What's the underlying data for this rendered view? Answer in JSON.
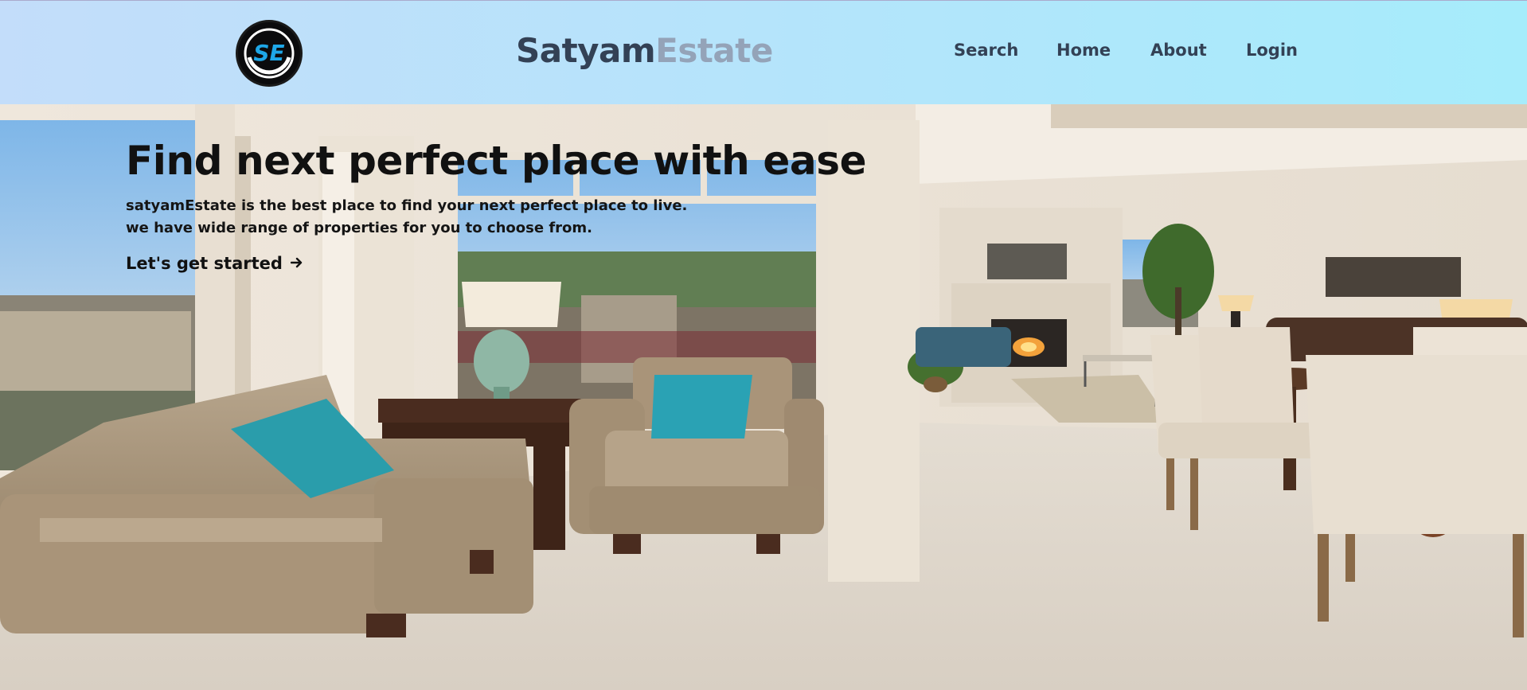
{
  "header": {
    "logo_text": "SE",
    "brand_part1": "Satyam",
    "brand_part2": "Estate",
    "nav": [
      {
        "label": "Search"
      },
      {
        "label": "Home"
      },
      {
        "label": "About"
      },
      {
        "label": "Login"
      }
    ]
  },
  "hero": {
    "title": "Find next perfect place with ease",
    "subtitle_line1": "satyamEstate is the best place to find your next perfect place to live.",
    "subtitle_line2": "we have wide range of properties for you to choose from.",
    "cta_label": "Let's get started",
    "cta_icon": "arrow-right-icon"
  },
  "colors": {
    "brand_dark": "#334155",
    "brand_light": "#94a3b8",
    "header_gradient_start": "#c3ddfa",
    "header_gradient_end": "#a6ecfb"
  }
}
